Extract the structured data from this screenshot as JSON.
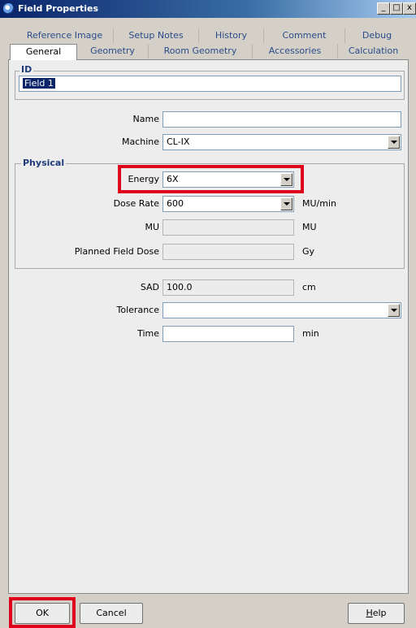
{
  "window": {
    "title": "Field Properties",
    "min_glyph": "_",
    "max_glyph": "□",
    "close_glyph": "x"
  },
  "tabs": {
    "row1": [
      "Reference Image",
      "Setup Notes",
      "History",
      "Comment",
      "Debug"
    ],
    "row2": [
      "General",
      "Geometry",
      "Room Geometry",
      "Accessories",
      "Calculation"
    ],
    "active": "General"
  },
  "id_group": {
    "title": "ID",
    "value": "Field 1"
  },
  "form": {
    "name": {
      "label": "Name",
      "value": ""
    },
    "machine": {
      "label": "Machine",
      "value": "CL-IX"
    }
  },
  "physical": {
    "title": "Physical",
    "energy": {
      "label": "Energy",
      "value": "6X"
    },
    "dose_rate": {
      "label": "Dose Rate",
      "value": "600",
      "unit": "MU/min"
    },
    "mu": {
      "label": "MU",
      "value": "",
      "unit": "MU"
    },
    "planned_field_dose": {
      "label": "Planned Field Dose",
      "value": "",
      "unit": "Gy"
    }
  },
  "other": {
    "sad": {
      "label": "SAD",
      "value": "100.0",
      "unit": "cm"
    },
    "tolerance": {
      "label": "Tolerance",
      "value": ""
    },
    "time": {
      "label": "Time",
      "value": "",
      "unit": "min"
    }
  },
  "buttons": {
    "ok": "OK",
    "cancel": "Cancel",
    "help_prefix": "H",
    "help_rest": "elp"
  },
  "colors": {
    "highlight": "#e0001b",
    "titlebar": "#0a246a",
    "tab_text": "#2a4c8a"
  }
}
